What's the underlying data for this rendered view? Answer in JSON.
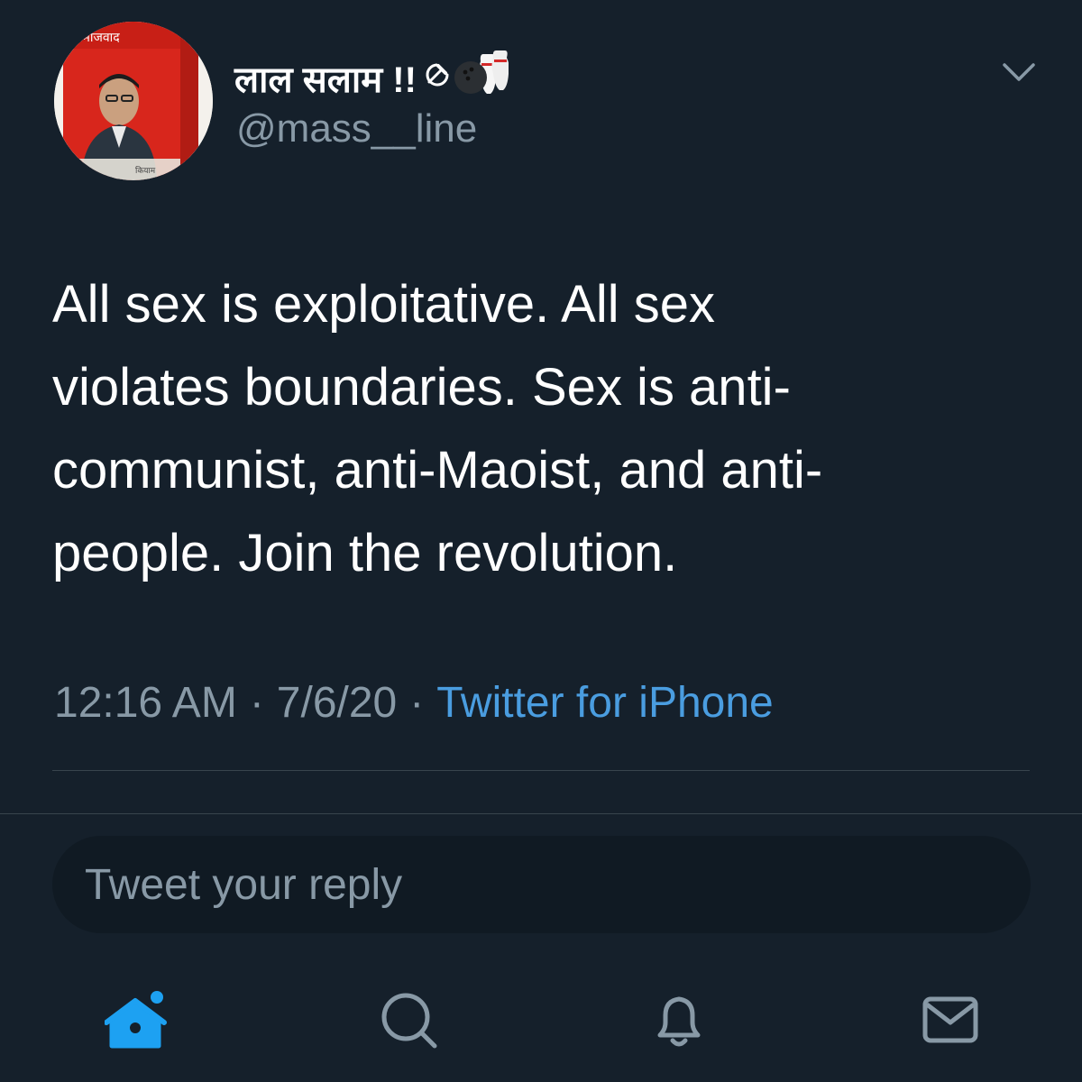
{
  "author": {
    "display_name": "लाल सलाम !!",
    "name_emojis": [
      "hammer-sickle-icon",
      "bowling-icon"
    ],
    "handle": "@mass__line",
    "avatar": "avatar-book-cover"
  },
  "tweet": {
    "text": "All sex is exploitative. All sex\nviolates boundaries. Sex is anti-\ncommunist, anti-Maoist, and anti-\npeople. Join the revolution.",
    "time": "12:16 AM",
    "separator": "·",
    "date": "7/6/20",
    "source": "Twitter for iPhone"
  },
  "reply": {
    "placeholder": "Tweet your reply"
  },
  "tabbar": {
    "items": [
      "home-icon",
      "search-icon",
      "notifications-icon",
      "messages-icon"
    ],
    "active": "home-icon",
    "home_has_dot": true
  },
  "colors": {
    "background": "#15202b",
    "accent": "#1da1f2",
    "link": "#4a9de0",
    "muted": "#8899a6",
    "divider": "#38444d",
    "reply_box": "#101a23"
  }
}
